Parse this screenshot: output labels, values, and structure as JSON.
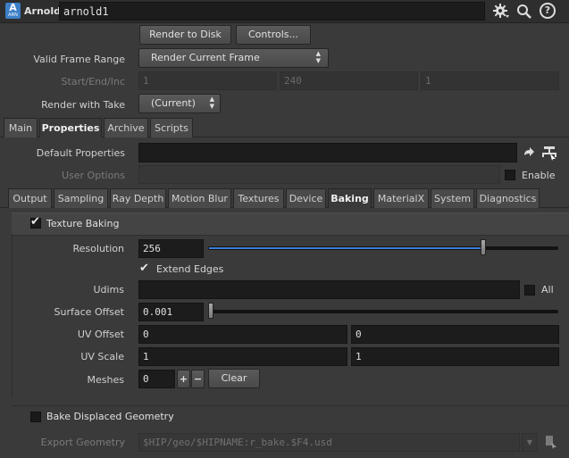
{
  "header": {
    "node_type_label": "Arnold",
    "node_name": "arnold1",
    "badge_letter": "A",
    "badge_sub": "ARN"
  },
  "buttons": {
    "render_to_disk": "Render to Disk",
    "controls": "Controls..."
  },
  "valid_frame_range": {
    "label": "Valid Frame Range",
    "value": "Render Current Frame"
  },
  "start_end_inc": {
    "label": "Start/End/Inc",
    "values": [
      "1",
      "240",
      "1"
    ]
  },
  "render_with_take": {
    "label": "Render with Take",
    "value": "(Current)"
  },
  "main_tabs": [
    "Main",
    "Properties",
    "Archive",
    "Scripts"
  ],
  "main_tab_active": "Properties",
  "default_properties": {
    "label": "Default Properties",
    "value": ""
  },
  "user_options": {
    "label": "User Options",
    "enable_label": "Enable"
  },
  "sub_tabs": [
    "Output",
    "Sampling",
    "Ray Depth",
    "Motion Blur",
    "Textures",
    "Device",
    "Baking",
    "MaterialX",
    "System",
    "Diagnostics"
  ],
  "sub_tab_active": "Baking",
  "baking": {
    "texture_baking_label": "Texture Baking",
    "texture_baking_checked": true,
    "resolution": {
      "label": "Resolution",
      "value": "256",
      "slider_fraction": 0.79
    },
    "extend_edges": {
      "label": "Extend Edges",
      "checked": true
    },
    "udims": {
      "label": "Udims",
      "value": "",
      "all_label": "All"
    },
    "surface_offset": {
      "label": "Surface Offset",
      "value": "0.001",
      "slider_fraction": 0.0
    },
    "uv_offset": {
      "label": "UV Offset",
      "values": [
        "0",
        "0"
      ]
    },
    "uv_scale": {
      "label": "UV Scale",
      "values": [
        "1",
        "1"
      ]
    },
    "meshes": {
      "label": "Meshes",
      "value": "0",
      "plus": "+",
      "minus": "−",
      "clear": "Clear"
    },
    "bake_displaced": {
      "label": "Bake Displaced Geometry",
      "checked": false
    },
    "export_geometry": {
      "label": "Export Geometry",
      "value": "$HIP/geo/$HIPNAME:r_bake.$F4.usd"
    }
  }
}
